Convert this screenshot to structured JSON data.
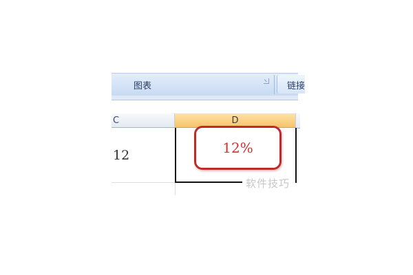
{
  "ribbon": {
    "group_label": "图表",
    "next_group_label": "链接"
  },
  "sheet": {
    "column_c_label": "C",
    "column_d_label": "D",
    "cell_c_value": "12",
    "cell_d_value": "12%"
  },
  "watermark": "软件技巧",
  "colors": {
    "highlight_circle": "#c0292a",
    "cell_d_text": "#d0302f",
    "selected_column_header": "#f7c36a",
    "ribbon": "#d4e3f6"
  }
}
